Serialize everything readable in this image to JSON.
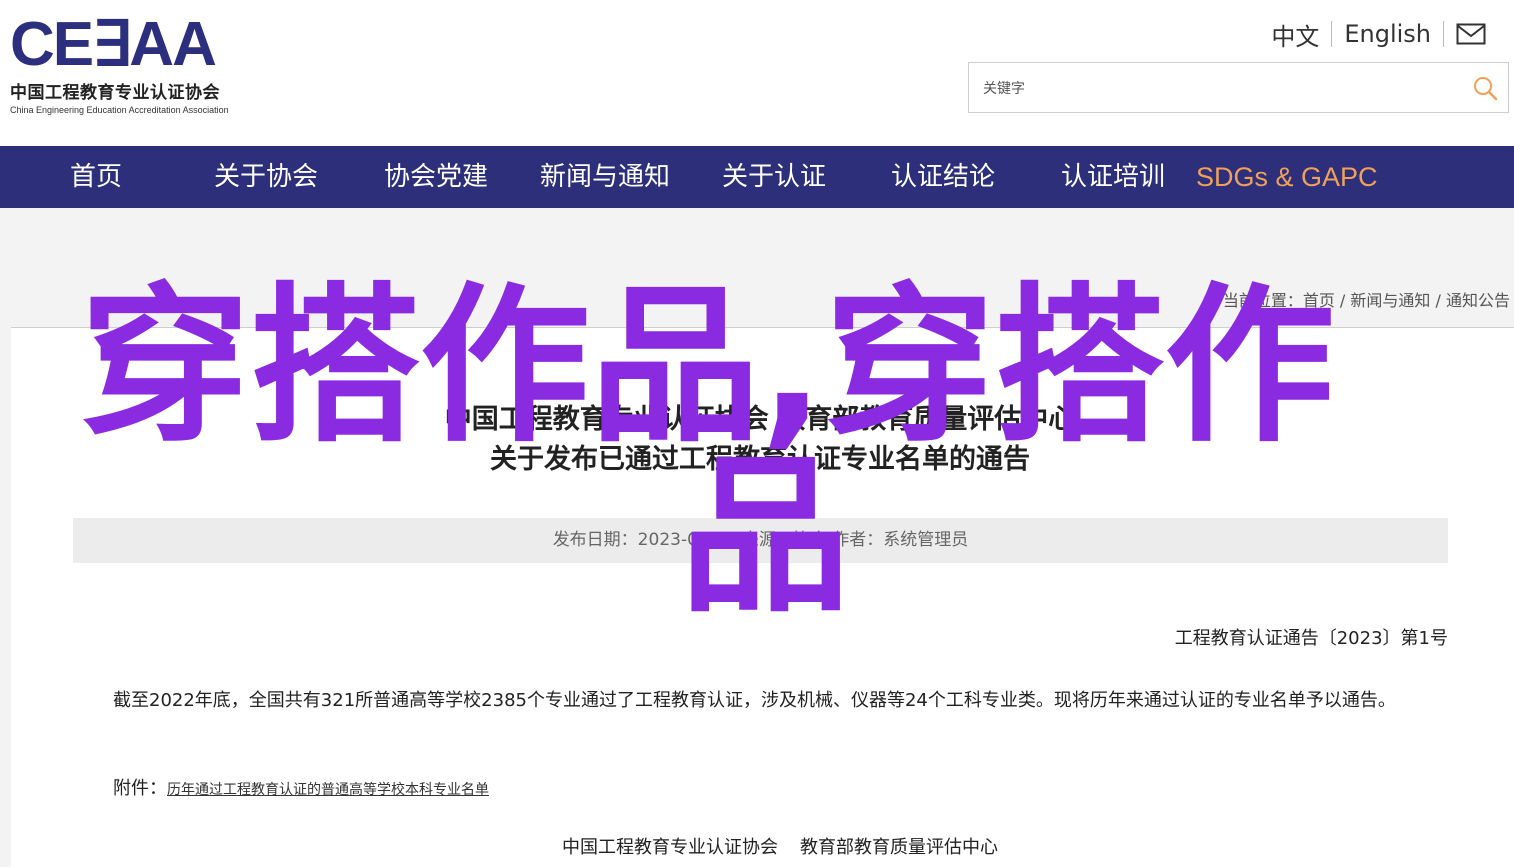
{
  "header": {
    "logo_mark": "CE∃AA",
    "logo_cn": "中国工程教育专业认证协会",
    "logo_en": "China Engineering Education Accreditation Association",
    "lang_cn": "中文",
    "lang_en": "English",
    "mail_icon": "mail-icon",
    "search_placeholder": "关键字",
    "search_icon": "search-icon"
  },
  "nav": {
    "items": [
      "首页",
      "关于协会",
      "协会党建",
      "新闻与通知",
      "关于认证",
      "认证结论",
      "认证培训",
      "SDGs & GAPC"
    ],
    "accent_color": "#f0a05a",
    "bar_color": "#2d2f7a"
  },
  "breadcrumb": {
    "prefix": "当前位置：",
    "home": "首页",
    "sep": " / ",
    "level1": "新闻与通知",
    "level2": "通知公告"
  },
  "article": {
    "title_line1": "中国工程教育专业认证协会 教育部教育质量评估中心",
    "title_line2": "关于发布已通过工程教育认证专业名单的通告",
    "meta": "发布日期：2023-06-28   来源：协会   作者：系统管理员",
    "doc_number": "工程教育认证通告〔2023〕第1号",
    "body": "截至2022年底，全国共有321所普通高等学校2385个专业通过了工程教育认证，涉及机械、仪器等24个工科专业类。现将历年来通过认证的专业名单予以通告。",
    "attachment_label": "附件：",
    "attachment_link": "历年通过工程教育认证的普通高等学校本科专业名单",
    "signer1": "中国工程教育专业认证协会",
    "signer2": "教育部教育质量评估中心"
  },
  "overlay": {
    "line1": "穿搭作品,穿搭作",
    "line2": "品",
    "color": "#8a2be2"
  }
}
